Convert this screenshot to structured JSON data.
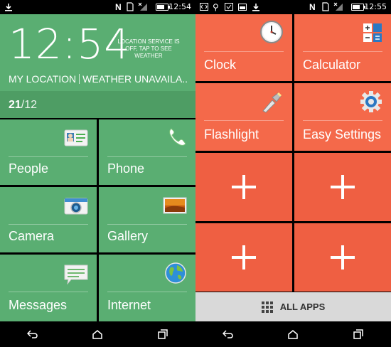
{
  "status": {
    "time": "12:54"
  },
  "status_right": {
    "time": "12:55"
  },
  "clock_panel": {
    "time": "12:54",
    "location_service_msg": "LOCATION SERVICE IS OFF, TAP TO SEE WEATHER",
    "my_location": "MY LOCATION",
    "weather": "WEATHER UNAVAILA..",
    "date_day": "21",
    "date_month": "/12"
  },
  "left_tiles": [
    {
      "label": "People",
      "icon": "contact-card-icon"
    },
    {
      "label": "Phone",
      "icon": "phone-icon"
    },
    {
      "label": "Camera",
      "icon": "camera-icon"
    },
    {
      "label": "Gallery",
      "icon": "gallery-icon"
    },
    {
      "label": "Messages",
      "icon": "messages-icon"
    },
    {
      "label": "Internet",
      "icon": "globe-icon"
    }
  ],
  "right_tiles": [
    {
      "label": "Clock",
      "icon": "clock-icon"
    },
    {
      "label": "Calculator",
      "icon": "calculator-icon"
    },
    {
      "label": "Flashlight",
      "icon": "flashlight-icon"
    },
    {
      "label": "Easy Settings",
      "icon": "gear-icon"
    }
  ],
  "all_apps": {
    "label": "ALL APPS"
  },
  "colors": {
    "green": "#5aae72",
    "green_dark": "#4e9d64",
    "orange": "#f4694a",
    "orange_dark": "#ef5f42",
    "allapps_bg": "#d9d9d9"
  }
}
